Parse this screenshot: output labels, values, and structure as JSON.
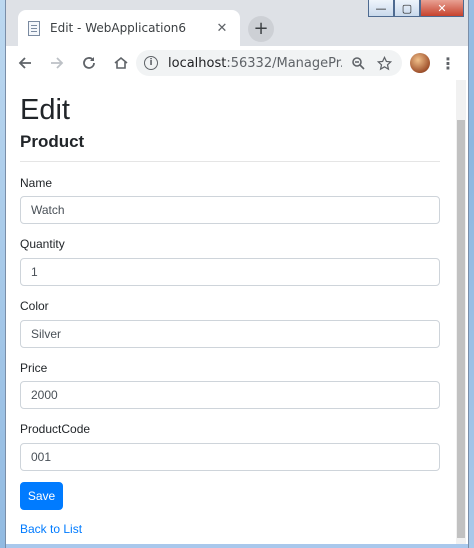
{
  "window": {
    "controls": {
      "minimize": "—",
      "maximize": "▢",
      "close": "✕"
    }
  },
  "tab": {
    "title": "Edit - WebApplication6",
    "close": "✕"
  },
  "newtab": {
    "label": "+"
  },
  "toolbar": {
    "url_host": "localhost",
    "url_rest": ":56332/ManagePr..."
  },
  "page": {
    "heading": "Edit",
    "subheading": "Product",
    "fields": [
      {
        "label": "Name",
        "value": "Watch"
      },
      {
        "label": "Quantity",
        "value": "1"
      },
      {
        "label": "Color",
        "value": "Silver"
      },
      {
        "label": "Price",
        "value": "2000"
      },
      {
        "label": "ProductCode",
        "value": "001"
      }
    ],
    "save_label": "Save",
    "back_label": "Back to List"
  },
  "colors": {
    "primary": "#007bff",
    "text": "#212529",
    "input_border": "#ced4da"
  }
}
